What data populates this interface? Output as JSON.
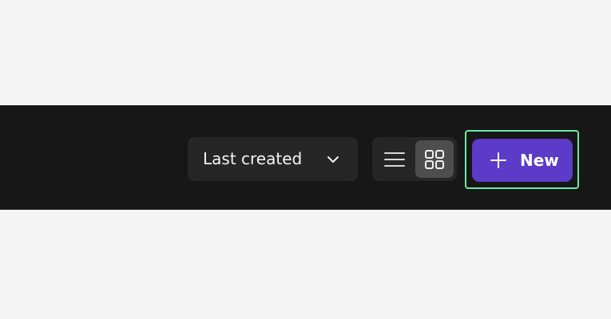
{
  "toolbar": {
    "sort": {
      "selected": "Last created",
      "icon": "chevron-down-icon"
    },
    "view_toggle": {
      "options": [
        {
          "id": "list",
          "icon": "list-view-icon",
          "active": false
        },
        {
          "id": "grid",
          "icon": "grid-view-icon",
          "active": true
        }
      ]
    },
    "new_button": {
      "label": "New",
      "icon": "plus-icon"
    },
    "colors": {
      "toolbar_bg": "#171717",
      "control_bg": "#262626",
      "active_toggle_bg": "#4d4d4d",
      "accent": "#5b3bc8",
      "focus_outline": "#6ee7a6"
    }
  }
}
